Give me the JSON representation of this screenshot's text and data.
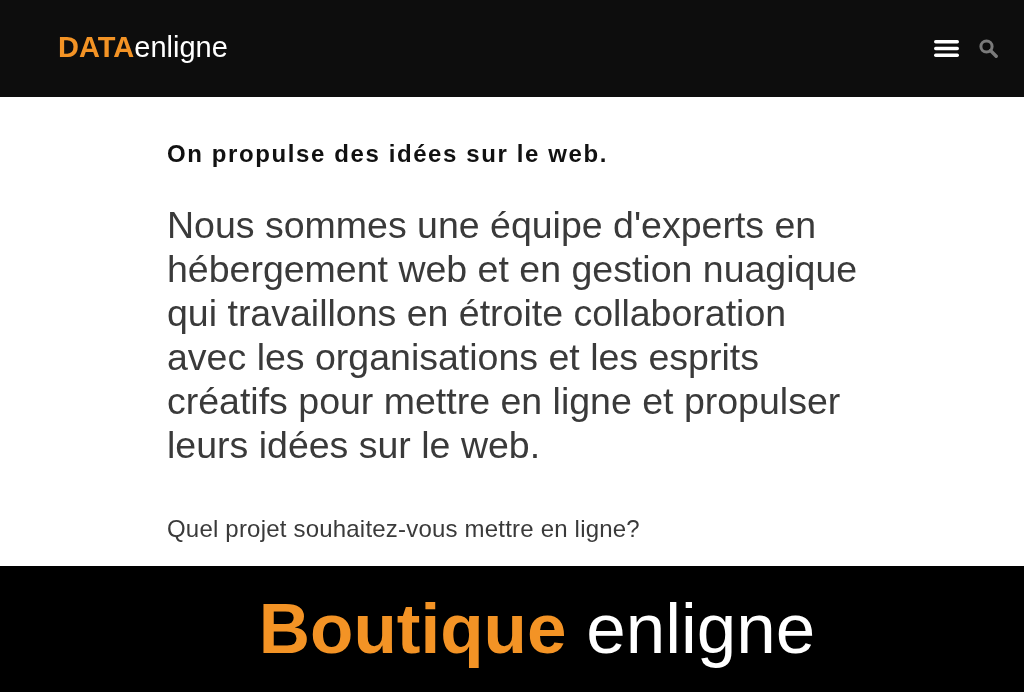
{
  "header": {
    "logo": {
      "strong": "DATA",
      "light": "enligne"
    }
  },
  "content": {
    "tagline": "On propulse des idées sur le web.",
    "intro": "Nous sommes une équipe d'experts en hébergement web et en gestion nuagique qui travaillons en étroite collaboration avec les organisations et les esprits créatifs pour mettre en ligne et propulser leurs idées sur le web.",
    "question": "Quel projet souhaitez-vous mettre en ligne?"
  },
  "banner": {
    "highlight": "Boutique",
    "rest": "enligne"
  }
}
